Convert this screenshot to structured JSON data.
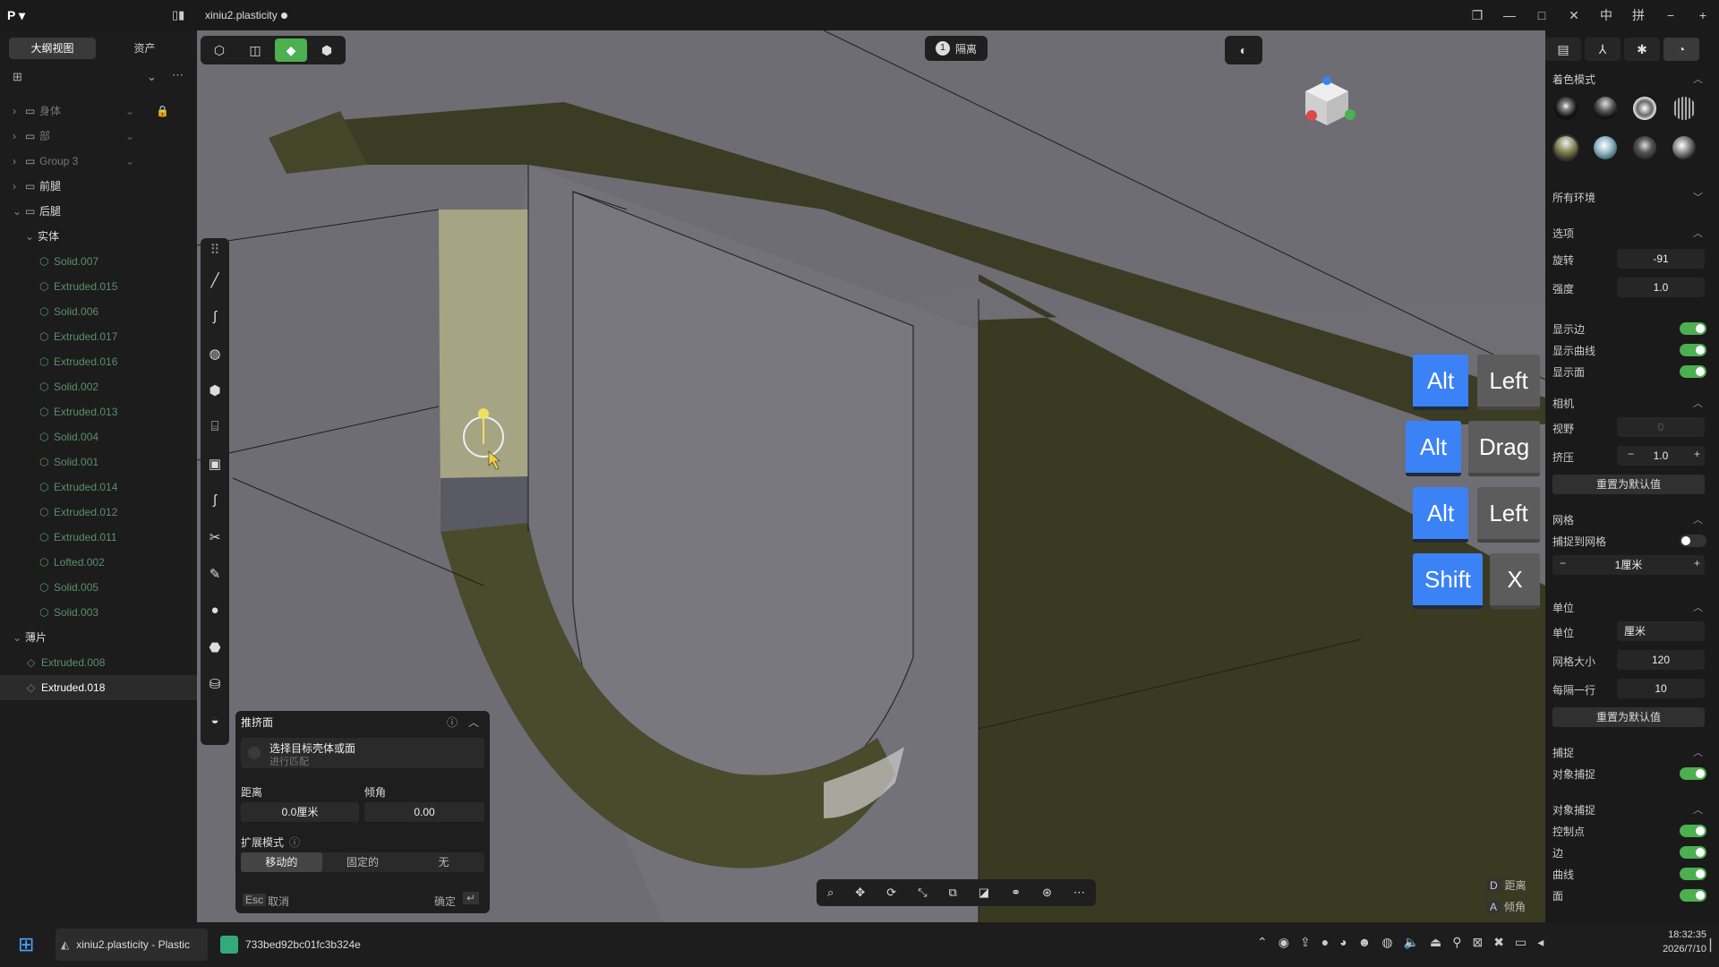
{
  "window": {
    "title": "xiniu2.plasticity",
    "controls": [
      "❐",
      "—",
      "□",
      "✕",
      "中",
      "拼",
      "−",
      "+"
    ]
  },
  "left_panel": {
    "tabs": [
      "大纲视图",
      "资产"
    ],
    "tree": [
      {
        "label": "身体",
        "icon": "folder",
        "style": "dim"
      },
      {
        "label": "部",
        "icon": "folder",
        "style": "dim"
      },
      {
        "label": "Group 3",
        "icon": "folder",
        "style": "dim"
      },
      {
        "label": "前腿",
        "icon": "folder",
        "style": "normal"
      },
      {
        "label": "后腿",
        "icon": "folder",
        "style": "normal"
      },
      {
        "label": "实体",
        "icon": "none",
        "style": "normal"
      },
      {
        "label": "Solid.007",
        "icon": "solid",
        "style": "solid"
      },
      {
        "label": "Extruded.015",
        "icon": "solid",
        "style": "solid"
      },
      {
        "label": "Solid.006",
        "icon": "solid",
        "style": "solid"
      },
      {
        "label": "Extruded.017",
        "icon": "solid",
        "style": "solid"
      },
      {
        "label": "Extruded.016",
        "icon": "solid",
        "style": "solid"
      },
      {
        "label": "Solid.002",
        "icon": "solid",
        "style": "solid"
      },
      {
        "label": "Extruded.013",
        "icon": "solid",
        "style": "solid"
      },
      {
        "label": "Solid.004",
        "icon": "solid",
        "style": "solid"
      },
      {
        "label": "Solid.001",
        "icon": "solid",
        "style": "solid"
      },
      {
        "label": "Extruded.014",
        "icon": "solid",
        "style": "solid"
      },
      {
        "label": "Extruded.012",
        "icon": "solid",
        "style": "solid"
      },
      {
        "label": "Extruded.011",
        "icon": "solid",
        "style": "solid"
      },
      {
        "label": "Lofted.002",
        "icon": "solid",
        "style": "solid"
      },
      {
        "label": "Solid.005",
        "icon": "solid",
        "style": "solid"
      },
      {
        "label": "Solid.003",
        "icon": "solid",
        "style": "solid"
      },
      {
        "label": "薄片",
        "icon": "none",
        "style": "normal"
      },
      {
        "label": "Extruded.008",
        "icon": "sheet",
        "style": "solid"
      },
      {
        "label": "Extruded.018",
        "icon": "sheet",
        "style": "selected"
      }
    ]
  },
  "viewport": {
    "isolate_label": "隔离",
    "keys": [
      {
        "mod": "Alt",
        "key": "Left"
      },
      {
        "mod": "Alt",
        "key": "Drag"
      },
      {
        "mod": "Alt",
        "key": "Left"
      },
      {
        "mod": "Shift",
        "key": "X"
      }
    ],
    "hints": [
      {
        "key": "D",
        "label": "距离"
      },
      {
        "key": "A",
        "label": "倾角"
      }
    ]
  },
  "extrude_panel": {
    "title": "推挤面",
    "select_title": "选择目标壳体或面",
    "select_sub": "进行匹配",
    "distance_label": "距离",
    "distance_value": "0.0厘米",
    "angle_label": "倾角",
    "angle_value": "0.00",
    "mode_label": "扩展模式",
    "modes": [
      "移动的",
      "固定的",
      "无"
    ],
    "esc_key": "Esc",
    "cancel": "取消",
    "confirm": "确定"
  },
  "right_panel": {
    "shading_title": "着色模式",
    "env_label": "所有环境",
    "options_title": "选项",
    "rotation_label": "旋转",
    "rotation_value": "-91",
    "strength_label": "强度",
    "strength_value": "1.0",
    "show_edges": "显示边",
    "show_curves": "显示曲线",
    "show_faces": "显示面",
    "camera_title": "相机",
    "fov_label": "视野",
    "fov_value": "0",
    "squash_label": "挤压",
    "squash_value": "1.0",
    "reset_label": "重置为默认值",
    "grid_title": "网格",
    "snap_grid": "捕捉到网格",
    "grid_value": "1厘米",
    "units_title": "单位",
    "units_label": "单位",
    "units_value": "厘米",
    "grid_size_label": "网格大小",
    "grid_size_value": "120",
    "every_row_label": "每隔一行",
    "every_row_value": "10",
    "snap_title": "捕捉",
    "object_snap": "对象捕捉",
    "object_snap_title": "对象捕捉",
    "snap_items": [
      "控制点",
      "边",
      "曲线",
      "面"
    ]
  },
  "taskbar": {
    "app1": "xiniu2.plasticity - Plastic",
    "app2": "733bed92bc01fc3b324e",
    "time": "18:32:35",
    "date": "2026/7/10"
  }
}
